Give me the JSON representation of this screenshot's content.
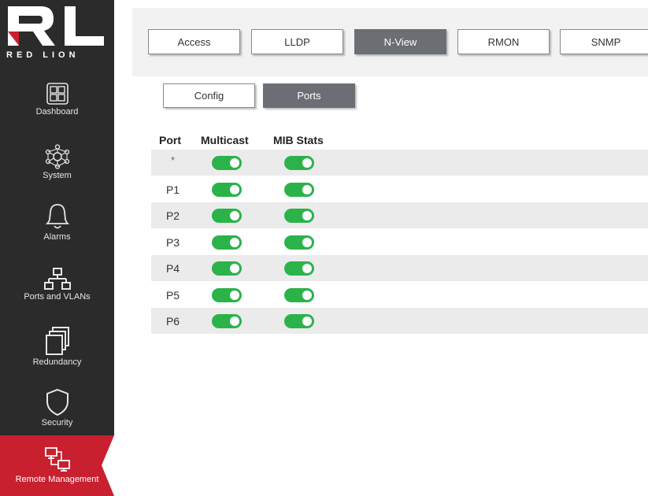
{
  "sidebar": {
    "brand": "RED LION",
    "items": [
      {
        "label": "Dashboard",
        "icon": "dashboard-icon"
      },
      {
        "label": "System",
        "icon": "network-hub-icon"
      },
      {
        "label": "Alarms",
        "icon": "bell-icon"
      },
      {
        "label": "Ports and VLANs",
        "icon": "network-tree-icon"
      },
      {
        "label": "Redundancy",
        "icon": "stacked-windows-icon"
      },
      {
        "label": "Security",
        "icon": "shield-icon"
      },
      {
        "label": "Remote Management",
        "icon": "remote-computers-icon"
      }
    ],
    "active": "Remote Management"
  },
  "tabs": [
    "Access",
    "LLDP",
    "N-View",
    "RMON",
    "SNMP"
  ],
  "active_tab": "N-View",
  "subtabs": [
    "Config",
    "Ports"
  ],
  "active_subtab": "Ports",
  "table": {
    "headers": [
      "Port",
      "Multicast",
      "MIB Stats"
    ],
    "rows": [
      {
        "port": "*",
        "multicast": true,
        "mib_stats": true
      },
      {
        "port": "P1",
        "multicast": true,
        "mib_stats": true
      },
      {
        "port": "P2",
        "multicast": true,
        "mib_stats": true
      },
      {
        "port": "P3",
        "multicast": true,
        "mib_stats": true
      },
      {
        "port": "P4",
        "multicast": true,
        "mib_stats": true
      },
      {
        "port": "P5",
        "multicast": true,
        "mib_stats": true
      },
      {
        "port": "P6",
        "multicast": true,
        "mib_stats": true
      }
    ]
  },
  "colors": {
    "sidebar_bg": "#2b2b2b",
    "accent_red": "#c8202f",
    "toggle_on": "#2bb34a",
    "active_tab": "#6b6e73"
  }
}
